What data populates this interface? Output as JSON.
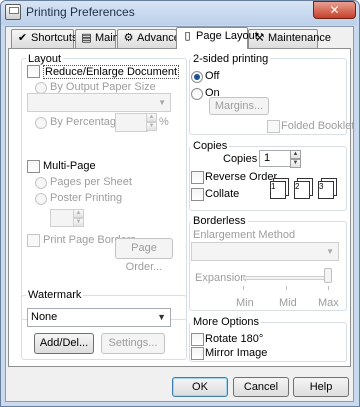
{
  "window": {
    "title": "Printing Preferences",
    "close_symbol": "✕"
  },
  "tabs": [
    {
      "label": "Shortcuts",
      "icon": "checklist-icon",
      "glyph": "✔"
    },
    {
      "label": "Main",
      "icon": "printer-icon",
      "glyph": "▤"
    },
    {
      "label": "Advanced",
      "icon": "gear-icon",
      "glyph": "⚙"
    },
    {
      "label": "Page Layout",
      "icon": "page-icon",
      "glyph": "▯"
    },
    {
      "label": "Maintenance",
      "icon": "wrench-icon",
      "glyph": "⚒"
    }
  ],
  "active_tab": "Page Layout",
  "layout": {
    "title": "Layout",
    "reduce_enlarge": {
      "label": "Reduce/Enlarge Document",
      "checked": false
    },
    "by_output_paper_size": "By Output Paper Size",
    "output_paper_select": "",
    "by_percentage": "By Percentage",
    "percentage_value": "",
    "percent_sign": "%",
    "multi_page": {
      "label": "Multi-Page",
      "checked": false
    },
    "pages_per_sheet": "Pages per Sheet",
    "poster_printing": "Poster Printing",
    "pages_select": "",
    "print_page_borders": "Print Page Borders",
    "page_order_button": "Page Order..."
  },
  "two_sided": {
    "title": "2-sided printing",
    "off": "Off",
    "on": "On",
    "selected": "Off",
    "margins_button": "Margins...",
    "folded_booklet": "Folded Booklet"
  },
  "copies": {
    "title": "Copies",
    "copies_label": "Copies",
    "copies_value": "1",
    "reverse_order": "Reverse Order",
    "collate": "Collate",
    "collate_icons": [
      "1",
      "2",
      "3"
    ]
  },
  "borderless": {
    "title": "Borderless",
    "enlargement_method": "Enlargement Method",
    "method_select": "",
    "expansion": "Expansion",
    "slider_level": 1.0,
    "slider_labels": [
      "Min",
      "Mid",
      "Max"
    ]
  },
  "watermark": {
    "title": "Watermark",
    "selected": "None",
    "add_del_button": "Add/Del...",
    "settings_button": "Settings..."
  },
  "more_options": {
    "title": "More Options",
    "rotate_180": "Rotate 180°",
    "mirror_image": "Mirror Image"
  },
  "footer": {
    "ok": "OK",
    "cancel": "Cancel",
    "help": "Help"
  }
}
